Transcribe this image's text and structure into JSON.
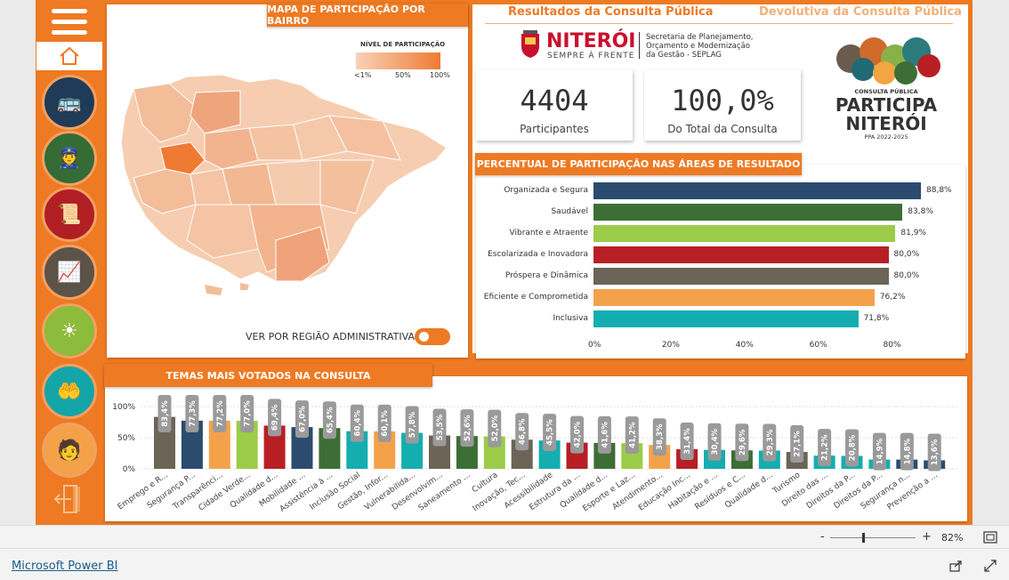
{
  "nav": {
    "link1": "Resultados da Consulta Pública",
    "link2": "Devolutiva da Consulta Pública"
  },
  "sidebar": {
    "icons": [
      {
        "name": "transport-icon",
        "color": "#1f3b58"
      },
      {
        "name": "security-guard-icon",
        "color": "#356b35"
      },
      {
        "name": "certificate-icon",
        "color": "#b11f24"
      },
      {
        "name": "economy-chart-icon",
        "color": "#5b5347"
      },
      {
        "name": "sun-icon",
        "color": "#8dbb3b"
      },
      {
        "name": "hands-care-icon",
        "color": "#14a5a9"
      },
      {
        "name": "podium-person-icon",
        "color": "#f4a24a"
      }
    ]
  },
  "map": {
    "title": "MAPA DE PARTICIPAÇÃO POR BAIRRO",
    "legend_title": "NÍVEL DE PARTICIPAÇÃO",
    "legend_ticks": [
      "<1%",
      "50%",
      "100%"
    ],
    "toggle_label": "VER POR REGIÃO ADMINISTRATIVA"
  },
  "logo": {
    "niteroi": "NITERÓI",
    "tagline": "SEMPRE À FRENTE",
    "secretaria": [
      "Secretaria de Planejamento,",
      "Orçamento e Modernização",
      "da Gestão - SEPLAG"
    ],
    "participa_top": "CONSULTA PÚBLICA",
    "participa_1": "PARTICIPA",
    "participa_2": "NITERÓI",
    "participa_ppa": "PPA 2022-2025"
  },
  "kpis": {
    "participants_value": "4404",
    "participants_label": "Participantes",
    "total_value": "100,0%",
    "total_label": "Do Total da Consulta"
  },
  "chart_data": [
    {
      "type": "bar",
      "orientation": "horizontal",
      "title": "PERCENTUAL DE PARTICIPAÇÃO NAS ÁREAS DE RESULTADO",
      "categories": [
        "Organizada e Segura",
        "Saudável",
        "Vibrante e Atraente",
        "Escolarizada e Inovadora",
        "Próspera e Dinâmica",
        "Eficiente e Comprometida",
        "Inclusiva"
      ],
      "values": [
        88.8,
        83.8,
        81.9,
        80.0,
        80.0,
        76.2,
        71.8
      ],
      "value_labels": [
        "88,8%",
        "83,8%",
        "81,9%",
        "80,0%",
        "80,0%",
        "76,2%",
        "71,8%"
      ],
      "colors": [
        "#2b4c6f",
        "#3d6e35",
        "#9ccc49",
        "#b81f25",
        "#6b6457",
        "#f4a24a",
        "#14adb0"
      ],
      "xticks": [
        "0%",
        "20%",
        "40%",
        "60%",
        "80%"
      ],
      "xlim": [
        0,
        90
      ]
    },
    {
      "type": "bar",
      "title": "TEMAS MAIS VOTADOS NA CONSULTA",
      "categories": [
        "Emprego e R...",
        "Segurança P...",
        "Transparênci...",
        "Cidade Verde...",
        "Qualidade d...",
        "Mobilidade ...",
        "Assistência à ...",
        "Inclusão Social",
        "Gestão, Infor...",
        "Vulnerabilida...",
        "Desenvolvim...",
        "Saneamento ...",
        "Cultura",
        "Inovação, Tec...",
        "Acessibilidade",
        "Estrutura da ...",
        "Qualidade d...",
        "Esporte e Laz...",
        "Atendimento...",
        "Educação Inc...",
        "Habitação e ...",
        "Resíduos e C...",
        "Qualidade d...",
        "Turismo",
        "Direito das ...",
        "Direitos da P...",
        "Direitos da P...",
        "Segurança n...",
        "Prevenção a ..."
      ],
      "values": [
        83.4,
        77.3,
        77.2,
        77.0,
        69.4,
        67.0,
        65.4,
        60.4,
        60.1,
        57.8,
        53.5,
        52.6,
        52.0,
        46.8,
        45.5,
        42.0,
        41.6,
        41.2,
        38.3,
        31.4,
        30.4,
        29.6,
        29.3,
        27.1,
        21.2,
        20.8,
        14.9,
        14.8,
        13.6
      ],
      "value_labels": [
        "83,4%",
        "77,3%",
        "77,2%",
        "77,0%",
        "69,4%",
        "67,0%",
        "65,4%",
        "60,4%",
        "60,1%",
        "57,8%",
        "53,5%",
        "52,6%",
        "52,0%",
        "46,8%",
        "45,5%",
        "42,0%",
        "41,6%",
        "41,2%",
        "38,3%",
        "31,4%",
        "30,4%",
        "29,6%",
        "29,3%",
        "27,1%",
        "21,2%",
        "20,8%",
        "14,9%",
        "14,8%",
        "13,6%"
      ],
      "colors": [
        "#6b6457",
        "#2b4c6f",
        "#f4a24a",
        "#9ccc49",
        "#b81f25",
        "#2b4c6f",
        "#3d6e35",
        "#14adb0",
        "#f4a24a",
        "#14adb0",
        "#6b6457",
        "#3d6e35",
        "#9ccc49",
        "#6b6457",
        "#14adb0",
        "#b81f25",
        "#3d6e35",
        "#9ccc49",
        "#f4a24a",
        "#b81f25",
        "#14adb0",
        "#3d6e35",
        "#14adb0",
        "#6b6457",
        "#14adb0",
        "#14adb0",
        "#14adb0",
        "#2b4c6f",
        "#2b4c6f"
      ],
      "yticks": [
        "100%",
        "50%",
        "0%"
      ],
      "ylim": [
        0,
        100
      ]
    }
  ],
  "status": {
    "zoom_minus": "-",
    "zoom_plus": "+",
    "zoom_value": "82%"
  },
  "footer": {
    "brand": "Microsoft Power BI"
  }
}
